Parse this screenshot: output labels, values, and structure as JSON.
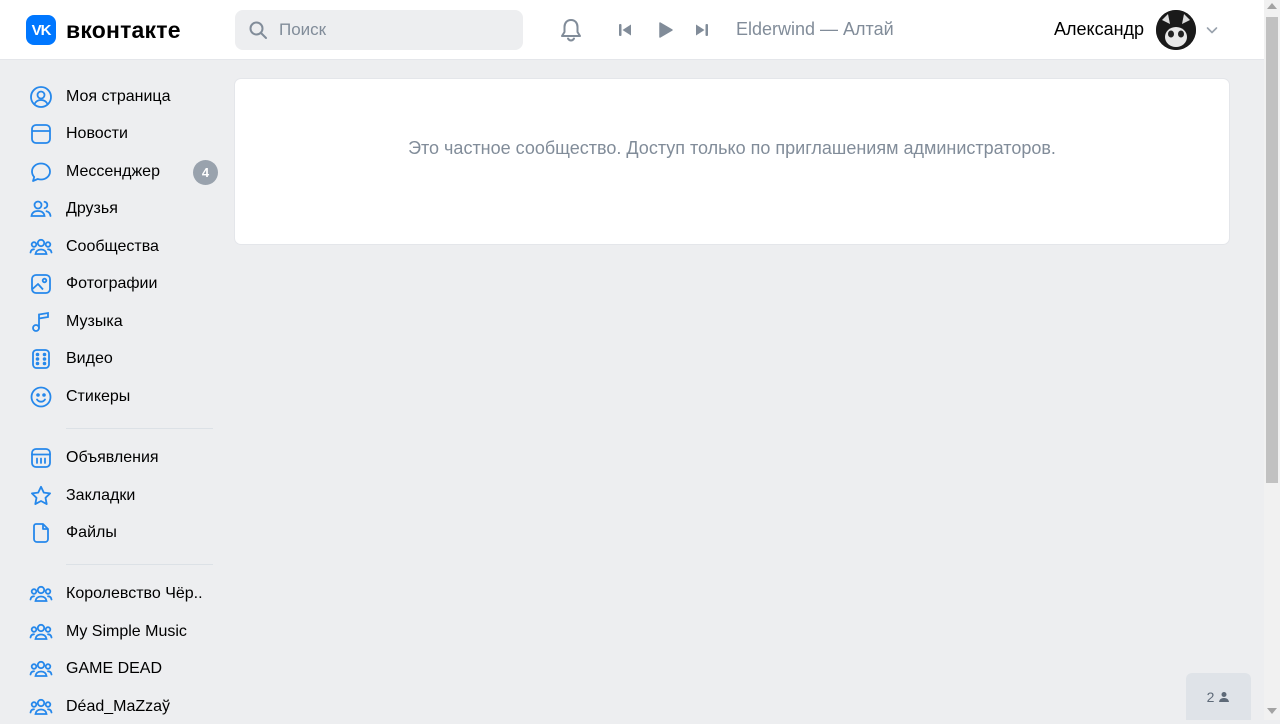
{
  "header": {
    "logo_text": "вконтакте",
    "logo_mark": "VK",
    "search_placeholder": "Поиск",
    "now_playing": "Elderwind — Алтай",
    "user_name": "Александр"
  },
  "sidebar": {
    "items": [
      {
        "label": "Моя страница",
        "icon": "user-circle-icon"
      },
      {
        "label": "Новости",
        "icon": "news-icon"
      },
      {
        "label": "Мессенджер",
        "icon": "message-icon",
        "badge": "4"
      },
      {
        "label": "Друзья",
        "icon": "friends-icon"
      },
      {
        "label": "Сообщества",
        "icon": "communities-icon"
      },
      {
        "label": "Фотографии",
        "icon": "photo-icon"
      },
      {
        "label": "Музыка",
        "icon": "music-icon"
      },
      {
        "label": "Видео",
        "icon": "video-icon"
      },
      {
        "label": "Стикеры",
        "icon": "smile-icon"
      }
    ],
    "items2": [
      {
        "label": "Объявления",
        "icon": "ads-icon"
      },
      {
        "label": "Закладки",
        "icon": "star-icon"
      },
      {
        "label": "Файлы",
        "icon": "file-icon"
      }
    ],
    "groups": [
      {
        "label": "Королевство Чёр..",
        "icon": "communities-icon"
      },
      {
        "label": "My Simple Music",
        "icon": "communities-icon"
      },
      {
        "label": "GAME DEAD",
        "icon": "communities-icon"
      },
      {
        "label": "Déad_MaZzaў",
        "icon": "communities-icon"
      }
    ]
  },
  "main": {
    "message": "Это частное сообщество. Доступ только по приглашениям администраторов."
  },
  "online_chip": {
    "count": "2"
  },
  "colors": {
    "accent": "#0077ff",
    "icon": "#2688eb",
    "muted": "#818c99",
    "background": "#edeef0"
  }
}
